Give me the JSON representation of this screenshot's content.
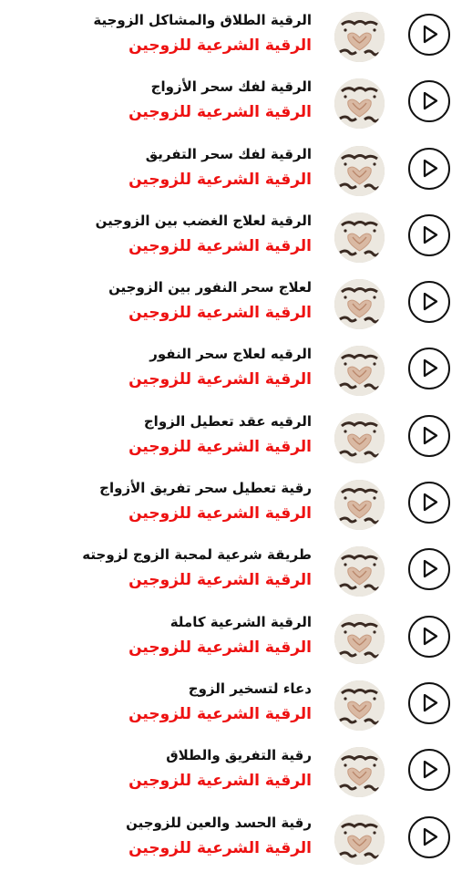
{
  "colors": {
    "title_text": "#111111",
    "artist_text": "#ee1111",
    "background": "#ffffff",
    "play_button_stroke": "#111111"
  },
  "icons": {
    "play": "play-circle-icon",
    "thumbnail": "album-art-thumbnail"
  },
  "tracks": [
    {
      "title": "الرقية الطلاق والمشاكل الزوجية",
      "artist": "الرقية الشرعية للزوجين"
    },
    {
      "title": "الرقية لفك سحر الأزواج",
      "artist": "الرقية الشرعية للزوجين"
    },
    {
      "title": "الرقية لفك سحر التفريق",
      "artist": "الرقية الشرعية للزوجين"
    },
    {
      "title": "الرقية لعلاج الغضب بين الزوجين",
      "artist": "الرقية الشرعية للزوجين"
    },
    {
      "title": "لعلاج سحر النفور بين الزوجين",
      "artist": "الرقية الشرعية للزوجين"
    },
    {
      "title": "الرقيه لعلاج سحر النفور",
      "artist": "الرقية الشرعية للزوجين"
    },
    {
      "title": "الرقيه عقد تعطيل الزواج",
      "artist": "الرقية الشرعية للزوجين"
    },
    {
      "title": "رقية تعطيل سحر تفريق الأزواج",
      "artist": "الرقية الشرعية للزوجين"
    },
    {
      "title": "طريقة شرعية لمحبة الزوج لزوجته",
      "artist": "الرقية الشرعية للزوجين"
    },
    {
      "title": "الرقية الشرعية كاملة",
      "artist": "الرقية الشرعية للزوجين"
    },
    {
      "title": "دعاء لتسخير الزوج",
      "artist": "الرقية الشرعية للزوجين"
    },
    {
      "title": "رقية التفريق والطلاق",
      "artist": "الرقية الشرعية للزوجين"
    },
    {
      "title": "رقية الحسد والعين للزوجين",
      "artist": "الرقية الشرعية للزوجين"
    }
  ]
}
